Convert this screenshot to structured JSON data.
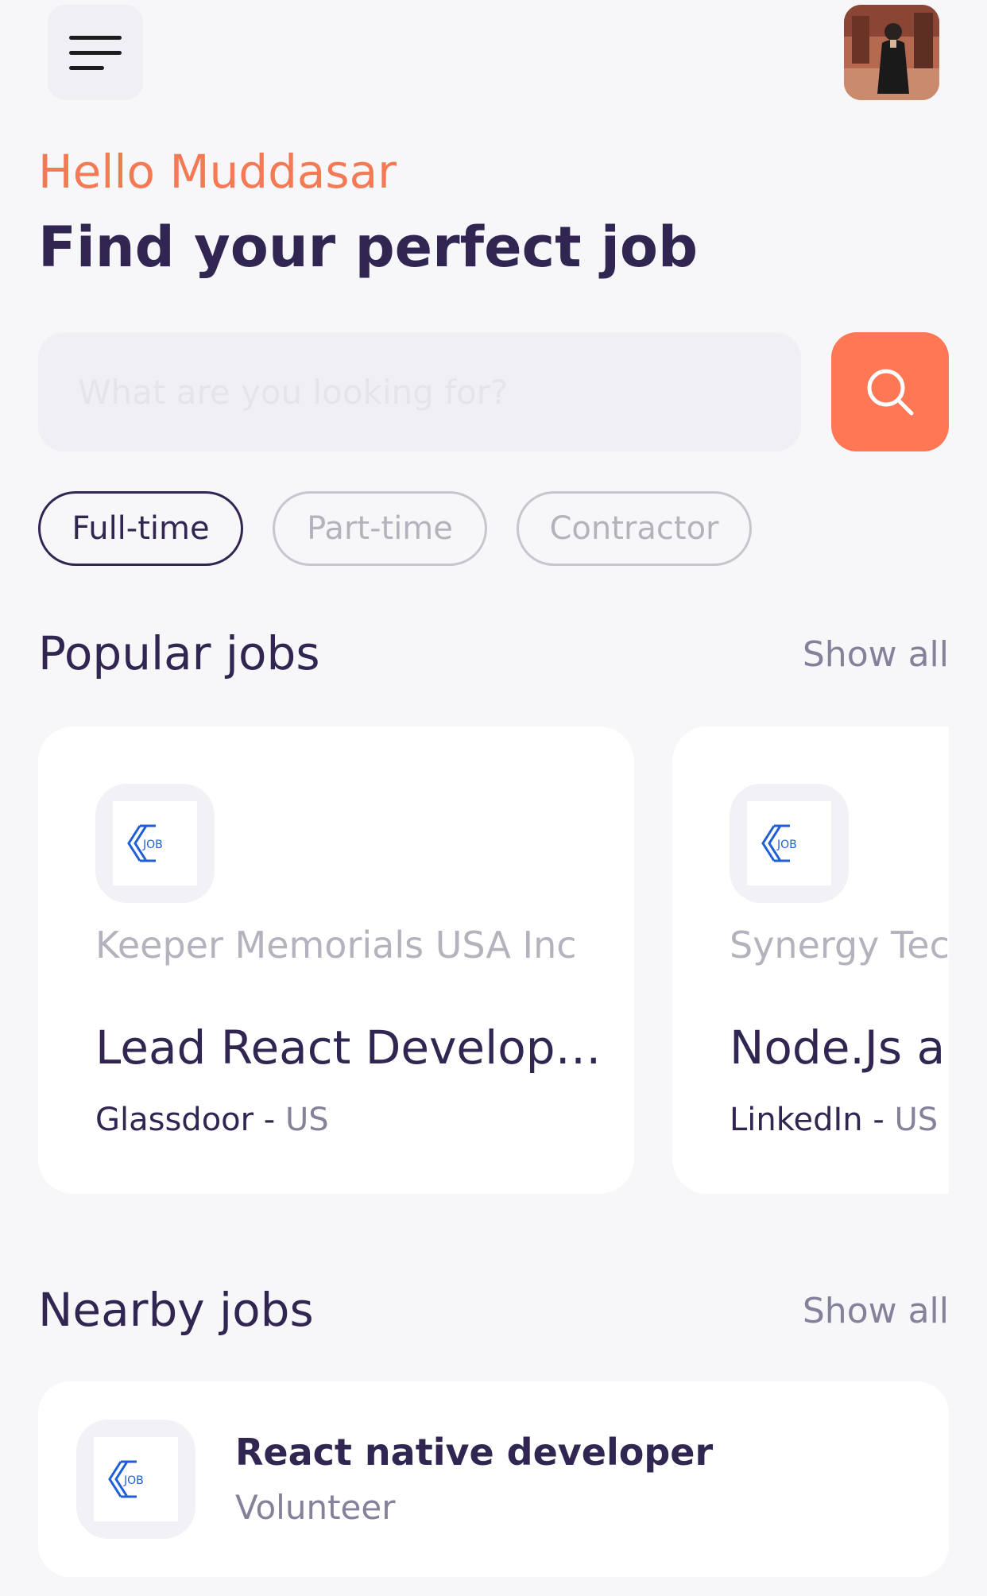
{
  "header": {
    "greeting": "Hello Muddasar",
    "headline": "Find your perfect job"
  },
  "search": {
    "placeholder": "What are you looking for?"
  },
  "job_types": [
    {
      "label": "Full-time",
      "active": true
    },
    {
      "label": "Part-time",
      "active": false
    },
    {
      "label": "Contractor",
      "active": false
    }
  ],
  "popular": {
    "title": "Popular jobs",
    "show_all": "Show all",
    "cards": [
      {
        "logo_text": "JOB",
        "company": "Keeper Memorials USA Inc",
        "title": "Lead React Develop…",
        "source": "Glassdoor",
        "separator": " - ",
        "location": "US"
      },
      {
        "logo_text": "JOB",
        "company": "Synergy Tecl",
        "title": "Node.Js a",
        "source": "LinkedIn",
        "separator": " - ",
        "location": "US"
      }
    ]
  },
  "nearby": {
    "title": "Nearby jobs",
    "show_all": "Show all",
    "items": [
      {
        "logo_text": "JOB",
        "title": "React native developer",
        "type": "Volunteer"
      }
    ]
  },
  "colors": {
    "accent": "#ff7754",
    "greeting": "#f47a55",
    "primary_text": "#312651",
    "secondary_text": "#83829a",
    "logo_blue": "#1f5fd6"
  }
}
